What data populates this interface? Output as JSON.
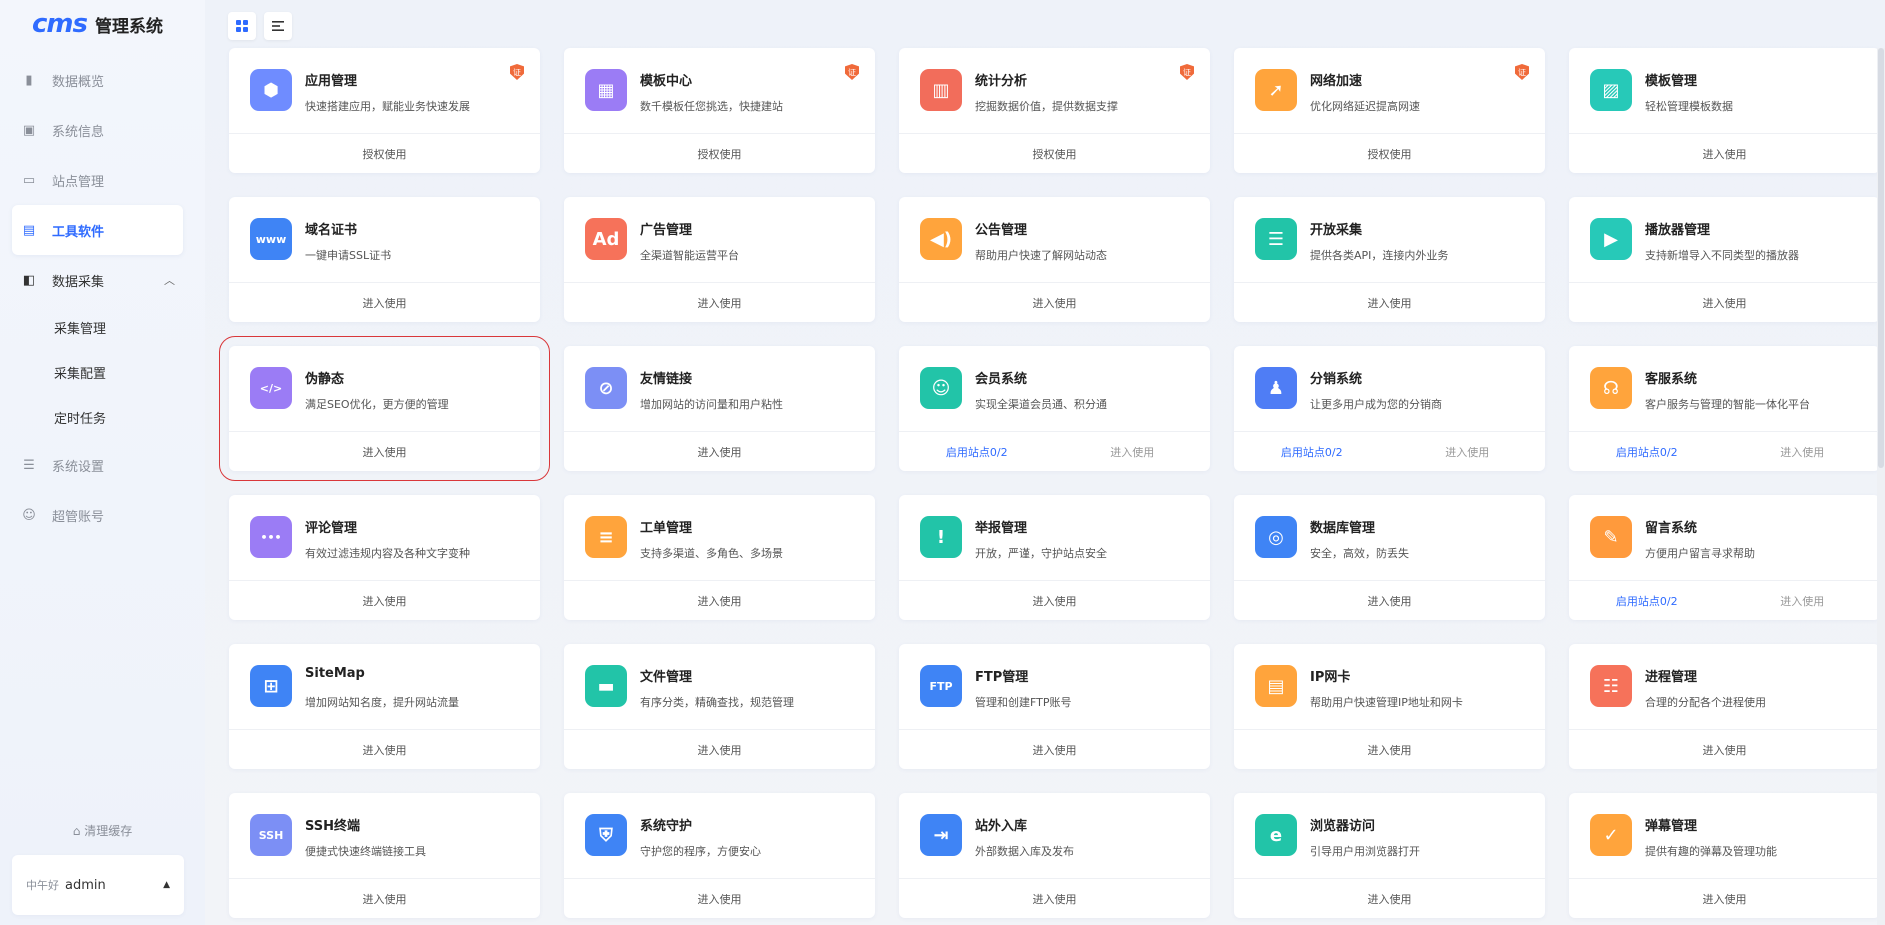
{
  "app": {
    "logo_mark": "cms",
    "title": "管理系统"
  },
  "sidebar": {
    "items": [
      {
        "label": "数据概览",
        "icon": "bar-chart-icon"
      },
      {
        "label": "系统信息",
        "icon": "chip-icon"
      },
      {
        "label": "站点管理",
        "icon": "monitor-icon"
      },
      {
        "label": "工具软件",
        "icon": "window-icon",
        "active": true
      },
      {
        "label": "数据采集",
        "icon": "database-icon",
        "open": true
      },
      {
        "label": "系统设置",
        "icon": "sliders-icon"
      },
      {
        "label": "超管账号",
        "icon": "user-icon"
      }
    ],
    "sub_items": [
      {
        "label": "采集管理"
      },
      {
        "label": "采集配置"
      },
      {
        "label": "定时任务"
      }
    ],
    "clear_cache": "清理缓存",
    "user": {
      "greeting": "中午好",
      "name": "admin"
    }
  },
  "toolbar": {
    "grid_view": "grid-view-icon",
    "list_view": "list-view-icon"
  },
  "cards": [
    {
      "title": "应用管理",
      "desc": "快速搭建应用，赋能业务快速发展",
      "icon": "cube-icon",
      "color": "#6f8cff",
      "badge": "证",
      "action": "授权使用"
    },
    {
      "title": "模板中心",
      "desc": "数千模板任您挑选，快捷建站",
      "icon": "layout-icon",
      "color": "#9b7cf5",
      "badge": "证",
      "action": "授权使用"
    },
    {
      "title": "统计分析",
      "desc": "挖掘数据价值，提供数据支撑",
      "icon": "stats-icon",
      "color": "#f26d5b",
      "badge": "证",
      "action": "授权使用"
    },
    {
      "title": "网络加速",
      "desc": "优化网络延迟提高网速",
      "icon": "rocket-icon",
      "color": "#ffa43c",
      "badge": "证",
      "action": "授权使用"
    },
    {
      "title": "模板管理",
      "desc": "轻松管理模板数据",
      "icon": "template-icon",
      "color": "#27c9b8",
      "action": "进入使用"
    },
    {
      "title": "域名证书",
      "desc": "一键申请SSL证书",
      "icon": "www-icon",
      "color": "#3f84f5",
      "action": "进入使用"
    },
    {
      "title": "广告管理",
      "desc": "全渠道智能运营平台",
      "icon": "ad-icon",
      "color": "#f6725a",
      "action": "进入使用"
    },
    {
      "title": "公告管理",
      "desc": "帮助用户快速了解网站动态",
      "icon": "megaphone-icon",
      "color": "#ffa43c",
      "action": "进入使用"
    },
    {
      "title": "开放采集",
      "desc": "提供各类API，连接内外业务",
      "icon": "server-icon",
      "color": "#22c4a8",
      "action": "进入使用"
    },
    {
      "title": "播放器管理",
      "desc": "支持新增导入不同类型的播放器",
      "icon": "play-icon",
      "color": "#27c9b8",
      "action": "进入使用"
    },
    {
      "title": "伪静态",
      "desc": "满足SEO优化，更方便的管理",
      "icon": "code-window-icon",
      "color": "#9b7cf5",
      "action": "进入使用",
      "highlight": true
    },
    {
      "title": "友情链接",
      "desc": "增加网站的访问量和用户粘性",
      "icon": "link-icon",
      "color": "#7c8ff5",
      "action": "进入使用"
    },
    {
      "title": "会员系统",
      "desc": "实现全渠道会员通、积分通",
      "icon": "member-icon",
      "color": "#22c4a8",
      "enable": "启用站点0/2",
      "action": "进入使用"
    },
    {
      "title": "分销系统",
      "desc": "让更多用户成为您的分销商",
      "icon": "team-icon",
      "color": "#4f7df5",
      "enable": "启用站点0/2",
      "action": "进入使用"
    },
    {
      "title": "客服系统",
      "desc": "客户服务与管理的智能一体化平台",
      "icon": "headset-icon",
      "color": "#ffa43c",
      "enable": "启用站点0/2",
      "action": "进入使用"
    },
    {
      "title": "评论管理",
      "desc": "有效过滤违规内容及各种文字变种",
      "icon": "comment-icon",
      "color": "#9b7cf5",
      "action": "进入使用"
    },
    {
      "title": "工单管理",
      "desc": "支持多渠道、多角色、多场景",
      "icon": "clipboard-icon",
      "color": "#ffa43c",
      "action": "进入使用"
    },
    {
      "title": "举报管理",
      "desc": "开放，严谨，守护站点安全",
      "icon": "warning-icon",
      "color": "#22c4a8",
      "action": "进入使用"
    },
    {
      "title": "数据库管理",
      "desc": "安全，高效，防丢失",
      "icon": "database-icon",
      "color": "#3f84f5",
      "action": "进入使用"
    },
    {
      "title": "留言系统",
      "desc": "方便用户留言寻求帮助",
      "icon": "chat-icon",
      "color": "#ff9a3c",
      "enable": "启用站点0/2",
      "action": "进入使用"
    },
    {
      "title": "SiteMap",
      "desc": "增加网站知名度，提升网站流量",
      "icon": "sitemap-icon",
      "color": "#3f84f5",
      "action": "进入使用"
    },
    {
      "title": "文件管理",
      "desc": "有序分类，精确查找，规范管理",
      "icon": "folder-icon",
      "color": "#22c4a8",
      "action": "进入使用"
    },
    {
      "title": "FTP管理",
      "desc": "管理和创建FTP账号",
      "icon": "ftp-icon",
      "color": "#3f84f5",
      "action": "进入使用"
    },
    {
      "title": "IP网卡",
      "desc": "帮助用户快速管理IP地址和网卡",
      "icon": "network-card-icon",
      "color": "#ffa43c",
      "action": "进入使用"
    },
    {
      "title": "进程管理",
      "desc": "合理的分配各个进程使用",
      "icon": "process-icon",
      "color": "#f6725a",
      "action": "进入使用"
    },
    {
      "title": "SSH终端",
      "desc": "便捷式快速终端链接工具",
      "icon": "ssh-icon",
      "color": "#7c8ff5",
      "action": "进入使用"
    },
    {
      "title": "系统守护",
      "desc": "守护您的程序，方便安心",
      "icon": "shield-server-icon",
      "color": "#3f84f5",
      "action": "进入使用"
    },
    {
      "title": "站外入库",
      "desc": "外部数据入库及发布",
      "icon": "file-import-icon",
      "color": "#3f84f5",
      "action": "进入使用"
    },
    {
      "title": "浏览器访问",
      "desc": "引导用户用浏览器打开",
      "icon": "browser-icon",
      "color": "#22c4a8",
      "action": "进入使用"
    },
    {
      "title": "弹幕管理",
      "desc": "提供有趣的弹幕及管理功能",
      "icon": "danmaku-icon",
      "color": "#ffa43c",
      "action": "进入使用"
    }
  ]
}
